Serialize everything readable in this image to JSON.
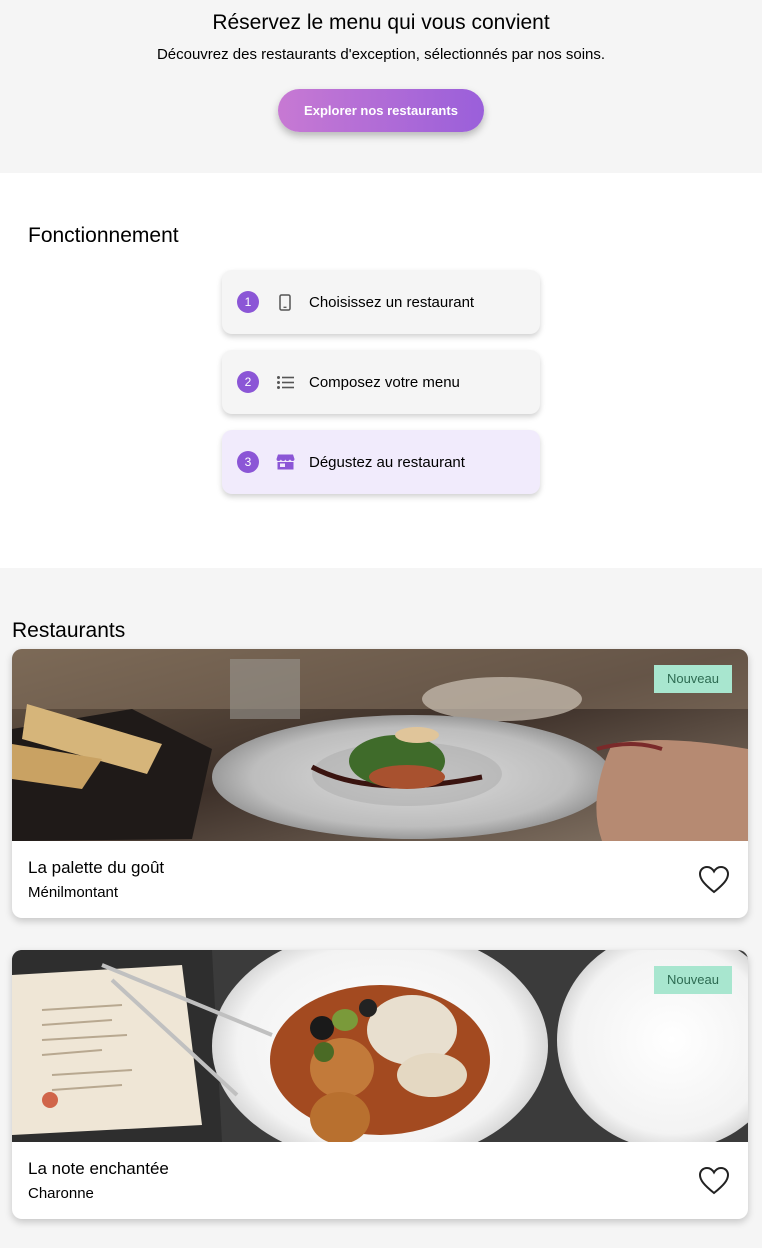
{
  "hero": {
    "title": "Réservez le menu qui vous convient",
    "subtitle": "Découvrez des restaurants d'exception, sélectionnés par nos soins.",
    "cta_label": "Explorer nos restaurants"
  },
  "how": {
    "title": "Fonctionnement",
    "steps": [
      {
        "num": "1",
        "icon": "smartphone-icon",
        "label": "Choisissez un restaurant"
      },
      {
        "num": "2",
        "icon": "list-icon",
        "label": "Composez votre menu"
      },
      {
        "num": "3",
        "icon": "store-icon",
        "label": "Dégustez au restaurant"
      }
    ]
  },
  "restaurants": {
    "title": "Restaurants",
    "items": [
      {
        "name": "La palette du goût",
        "area": "Ménilmontant",
        "badge": "Nouveau"
      },
      {
        "name": "La note enchantée",
        "area": "Charonne",
        "badge": "Nouveau"
      }
    ]
  },
  "colors": {
    "accent": "#8b56d6",
    "badge_bg": "#a8e6cf",
    "section_bg": "#f5f5f5"
  }
}
